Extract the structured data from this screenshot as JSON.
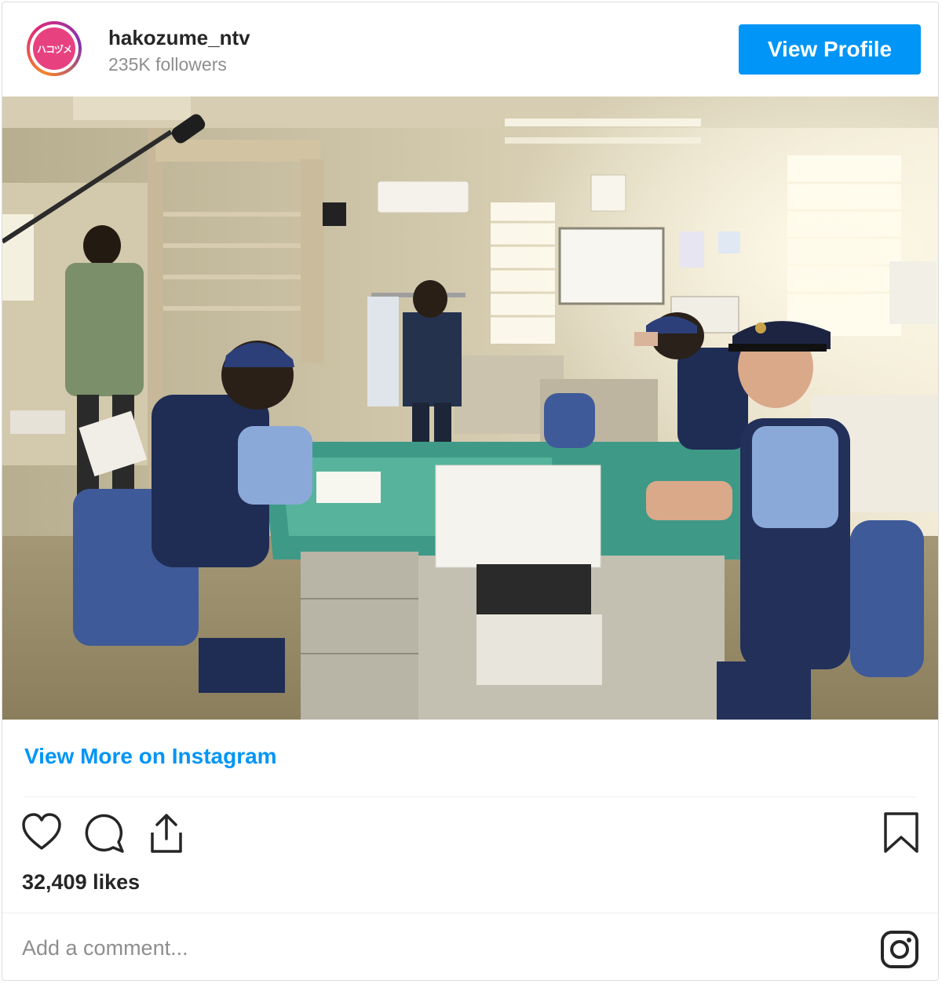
{
  "header": {
    "avatar_text": "ハコヅメ",
    "username": "hakozume_ntv",
    "followers": "235K followers",
    "view_profile_label": "View Profile"
  },
  "photo": {
    "scene": "police-office-set"
  },
  "footer": {
    "view_more_label": "View More on Instagram",
    "likes": "32,409 likes",
    "comment_placeholder": "Add a comment..."
  },
  "icons": {
    "like": "heart-icon",
    "comment": "comment-icon",
    "share": "share-icon",
    "save": "bookmark-icon",
    "instagram": "instagram-logo-icon"
  },
  "colors": {
    "accent": "#0095f6",
    "text": "#262626",
    "muted": "#8e8e8e",
    "avatar_brand": "#e8417f"
  }
}
